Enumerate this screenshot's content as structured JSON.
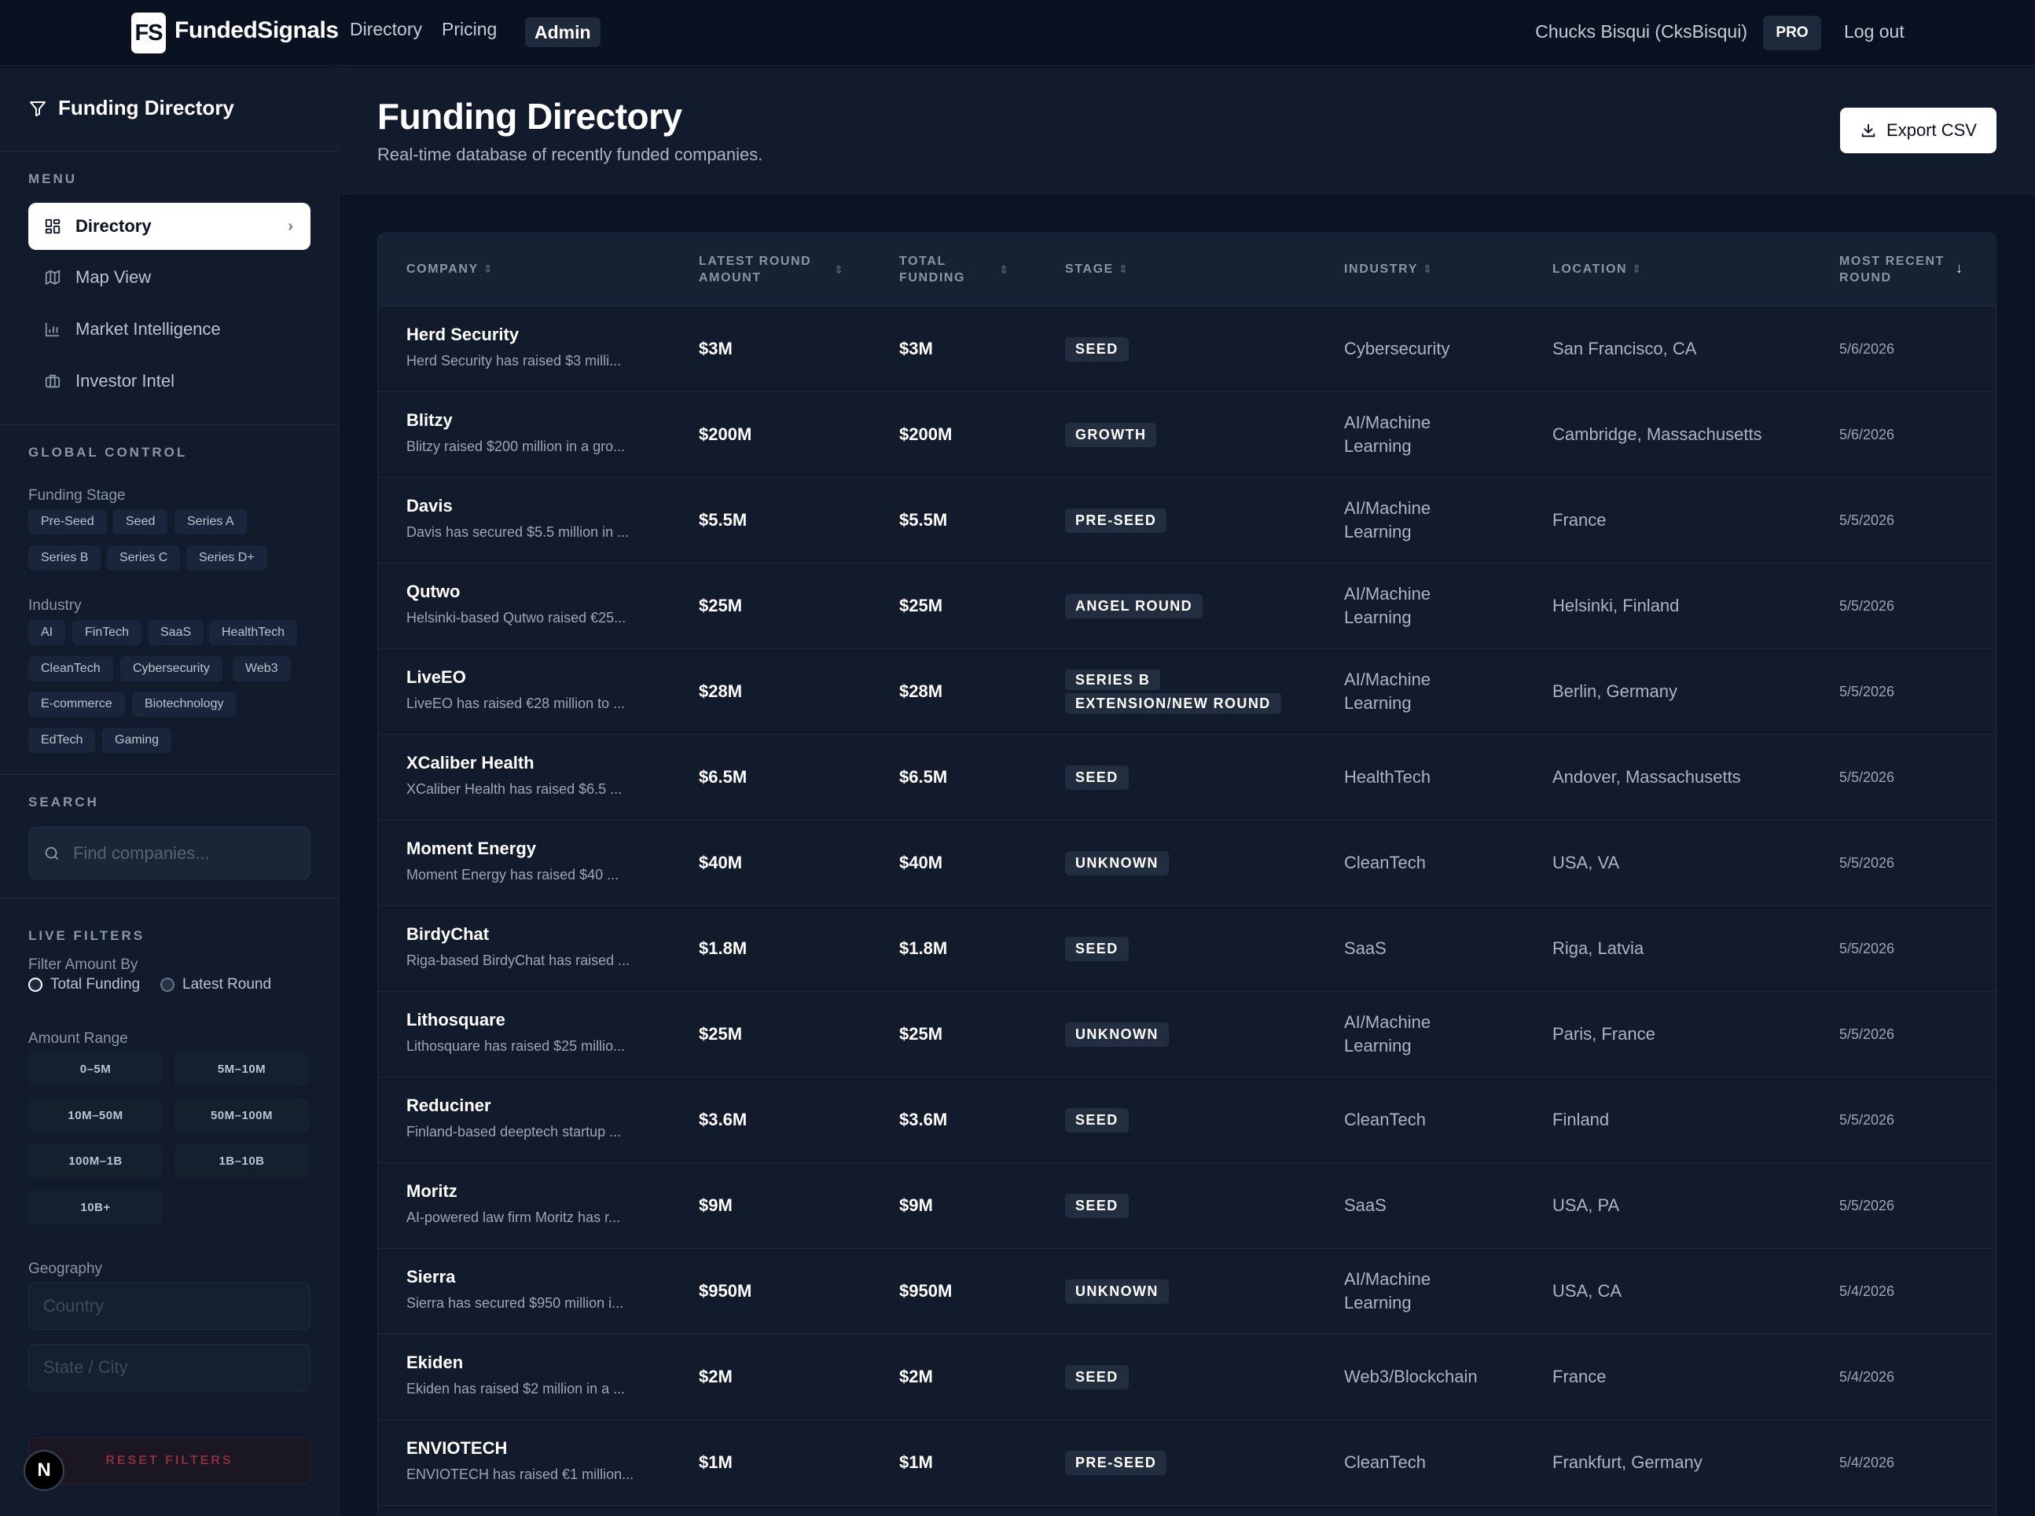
{
  "brand": {
    "mark": "FS",
    "name": "FundedSignals"
  },
  "nav": {
    "directory": "Directory",
    "pricing": "Pricing",
    "admin": "Admin"
  },
  "user": {
    "name": "Chucks Bisqui (CksBisqui)",
    "plan": "PRO",
    "logout": "Log out"
  },
  "sidebar": {
    "title": "Funding Directory",
    "menu_heading": "MENU",
    "menu": [
      {
        "label": "Directory",
        "icon": "grid-icon",
        "active": true
      },
      {
        "label": "Map View",
        "icon": "map-icon"
      },
      {
        "label": "Market Intelligence",
        "icon": "bar-chart-icon"
      },
      {
        "label": "Investor Intel",
        "icon": "briefcase-icon"
      }
    ],
    "global_heading": "GLOBAL CONTROL",
    "funding_stage_label": "Funding Stage",
    "funding_stages": [
      "Pre-Seed",
      "Seed",
      "Series A",
      "Series B",
      "Series C",
      "Series D+"
    ],
    "industry_label": "Industry",
    "industries": [
      "AI",
      "FinTech",
      "SaaS",
      "HealthTech",
      "CleanTech",
      "Cybersecurity",
      "Web3",
      "E-commerce",
      "Biotechnology",
      "EdTech",
      "Gaming"
    ],
    "search_heading": "SEARCH",
    "search_placeholder": "Find companies...",
    "live_heading": "LIVE FILTERS",
    "filter_by_label": "Filter Amount By",
    "filter_options": [
      "Total Funding",
      "Latest Round"
    ],
    "filter_selected": "Total Funding",
    "amount_label": "Amount Range",
    "amount_ranges": [
      "0–5M",
      "5M–10M",
      "10M–50M",
      "50M–100M",
      "100M–1B",
      "1B–10B",
      "10B+"
    ],
    "geo_label": "Geography",
    "country_placeholder": "Country",
    "city_placeholder": "State / City",
    "reset": "RESET FILTERS",
    "avatar_letter": "N"
  },
  "header": {
    "title": "Funding Directory",
    "subtitle": "Real-time database of recently funded companies.",
    "export": "Export CSV"
  },
  "columns": {
    "company": "COMPANY",
    "latest": "LATEST ROUND AMOUNT",
    "total": "TOTAL FUNDING",
    "stage": "STAGE",
    "industry": "INDUSTRY",
    "location": "LOCATION",
    "recent": "MOST RECENT ROUND"
  },
  "rows": [
    {
      "name": "Herd Security",
      "desc": "Herd Security has raised $3 milli...",
      "latest": "$3M",
      "total": "$3M",
      "stage": "SEED",
      "industry": "Cybersecurity",
      "location": "San Francisco, CA",
      "date": "5/6/2026"
    },
    {
      "name": "Blitzy",
      "desc": "Blitzy raised $200 million in a gro...",
      "latest": "$200M",
      "total": "$200M",
      "stage": "GROWTH",
      "industry": "AI/Machine Learning",
      "location": "Cambridge, Massachusetts",
      "date": "5/6/2026"
    },
    {
      "name": "Davis",
      "desc": "Davis has secured $5.5 million in ...",
      "latest": "$5.5M",
      "total": "$5.5M",
      "stage": "PRE-SEED",
      "industry": "AI/Machine Learning",
      "location": "France",
      "date": "5/5/2026"
    },
    {
      "name": "Qutwo",
      "desc": "Helsinki-based Qutwo raised €25...",
      "latest": "$25M",
      "total": "$25M",
      "stage": "ANGEL ROUND",
      "industry": "AI/Machine Learning",
      "location": "Helsinki, Finland",
      "date": "5/5/2026"
    },
    {
      "name": "LiveEO",
      "desc": "LiveEO has raised €28 million to ...",
      "latest": "$28M",
      "total": "$28M",
      "stage": "SERIES B EXTENSION/NEW ROUND",
      "industry": "AI/Machine Learning",
      "location": "Berlin, Germany",
      "date": "5/5/2026"
    },
    {
      "name": "XCaliber Health",
      "desc": "XCaliber Health has raised $6.5 ...",
      "latest": "$6.5M",
      "total": "$6.5M",
      "stage": "SEED",
      "industry": "HealthTech",
      "location": "Andover, Massachusetts",
      "date": "5/5/2026"
    },
    {
      "name": "Moment Energy",
      "desc": "Moment Energy has raised $40 ...",
      "latest": "$40M",
      "total": "$40M",
      "stage": "UNKNOWN",
      "industry": "CleanTech",
      "location": "USA, VA",
      "date": "5/5/2026"
    },
    {
      "name": "BirdyChat",
      "desc": "Riga-based BirdyChat has raised ...",
      "latest": "$1.8M",
      "total": "$1.8M",
      "stage": "SEED",
      "industry": "SaaS",
      "location": "Riga, Latvia",
      "date": "5/5/2026"
    },
    {
      "name": "Lithosquare",
      "desc": "Lithosquare has raised $25 millio...",
      "latest": "$25M",
      "total": "$25M",
      "stage": "UNKNOWN",
      "industry": "AI/Machine Learning",
      "location": "Paris, France",
      "date": "5/5/2026"
    },
    {
      "name": "Reduciner",
      "desc": "Finland-based deeptech startup ...",
      "latest": "$3.6M",
      "total": "$3.6M",
      "stage": "SEED",
      "industry": "CleanTech",
      "location": "Finland",
      "date": "5/5/2026"
    },
    {
      "name": "Moritz",
      "desc": "AI-powered law firm Moritz has r...",
      "latest": "$9M",
      "total": "$9M",
      "stage": "SEED",
      "industry": "SaaS",
      "location": "USA, PA",
      "date": "5/5/2026"
    },
    {
      "name": "Sierra",
      "desc": "Sierra has secured $950 million i...",
      "latest": "$950M",
      "total": "$950M",
      "stage": "UNKNOWN",
      "industry": "AI/Machine Learning",
      "location": "USA, CA",
      "date": "5/4/2026"
    },
    {
      "name": "Ekiden",
      "desc": "Ekiden has raised $2 million in a ...",
      "latest": "$2M",
      "total": "$2M",
      "stage": "SEED",
      "industry": "Web3/Blockchain",
      "location": "France",
      "date": "5/4/2026"
    },
    {
      "name": "ENVIOTECH",
      "desc": "ENVIOTECH has raised €1 million...",
      "latest": "$1M",
      "total": "$1M",
      "stage": "PRE-SEED",
      "industry": "CleanTech",
      "location": "Frankfurt, Germany",
      "date": "5/4/2026"
    }
  ]
}
